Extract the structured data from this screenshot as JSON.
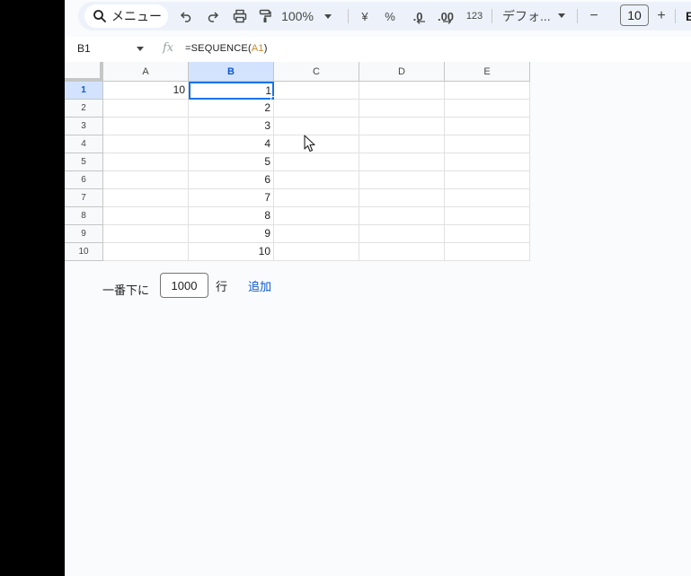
{
  "toolbar": {
    "search_label": "メニュー",
    "zoom": "100%",
    "currency_symbol": "¥",
    "percent_symbol": "%",
    "decrease_decimal": ".0",
    "increase_decimal": ".00",
    "number_format": "123",
    "font_name": "デフォ...",
    "font_size": "10",
    "minus": "−",
    "plus": "+",
    "bold": "B"
  },
  "formula_bar": {
    "name_box": "B1",
    "fx": "fx",
    "formula_prefix": "=SEQUENCE(",
    "formula_ref": "A1",
    "formula_suffix": ")"
  },
  "grid": {
    "columns": [
      "A",
      "B",
      "C",
      "D",
      "E"
    ],
    "rows": [
      "1",
      "2",
      "3",
      "4",
      "5",
      "6",
      "7",
      "8",
      "9",
      "10"
    ],
    "column_a": [
      "10",
      "",
      "",
      "",
      "",
      "",
      "",
      "",
      "",
      ""
    ],
    "column_b": [
      "1",
      "2",
      "3",
      "4",
      "5",
      "6",
      "7",
      "8",
      "9",
      "10"
    ],
    "selected_cell": "B1"
  },
  "add_rows": {
    "prefix": "一番下に",
    "count": "1000",
    "suffix": "行",
    "button": "追加"
  },
  "colors": {
    "accent": "#1a73e8",
    "header_selected": "#d3e3fd",
    "toolbar_bg": "#edf2fa",
    "link": "#0b57d0"
  }
}
